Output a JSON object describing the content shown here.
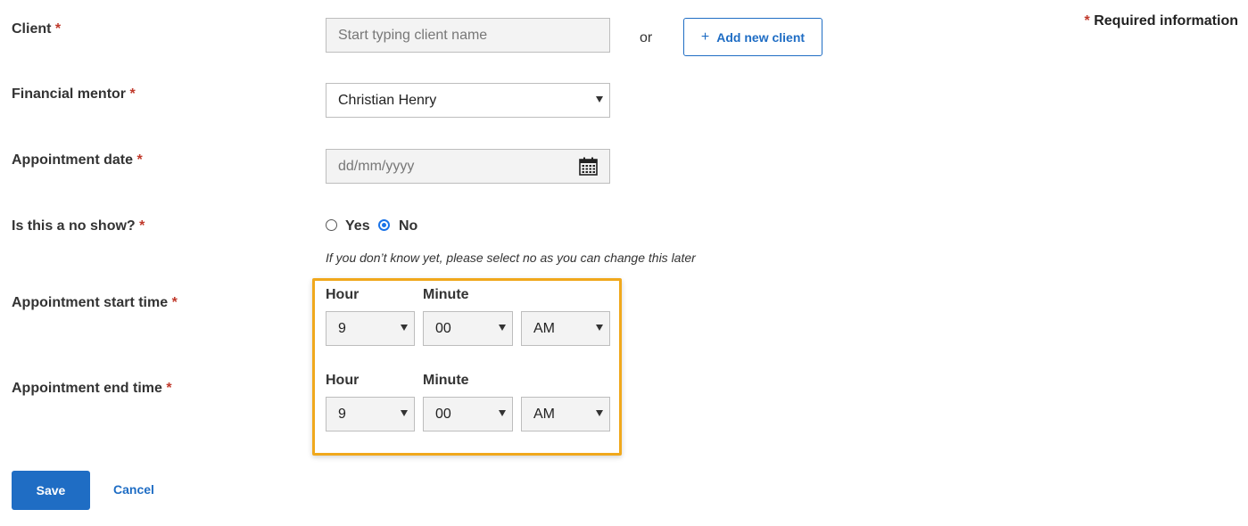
{
  "required_info": {
    "star": "*",
    "text": "Required information"
  },
  "client": {
    "label": "Client",
    "placeholder": "Start typing client name",
    "or_text": "or",
    "add_button": {
      "icon": "+",
      "label": "Add new client"
    }
  },
  "mentor": {
    "label": "Financial mentor",
    "selected": "Christian Henry"
  },
  "date": {
    "label": "Appointment date",
    "placeholder": "dd/mm/yyyy"
  },
  "no_show": {
    "label": "Is this a no show?",
    "options": [
      "Yes",
      "No"
    ],
    "selected": "No",
    "hint": "If you don’t know yet, please select no as you can change this later"
  },
  "start_time": {
    "label": "Appointment start time",
    "hour_label": "Hour",
    "minute_label": "Minute",
    "hour": "9",
    "minute": "00",
    "period": "AM"
  },
  "end_time": {
    "label": "Appointment end time",
    "hour_label": "Hour",
    "minute_label": "Minute",
    "hour": "9",
    "minute": "00",
    "period": "AM"
  },
  "required_star": "*",
  "actions": {
    "save": "Save",
    "cancel": "Cancel"
  },
  "colors": {
    "accent": "#1f6dc4",
    "required": "#c0392b",
    "highlight": "#f0a81c"
  }
}
